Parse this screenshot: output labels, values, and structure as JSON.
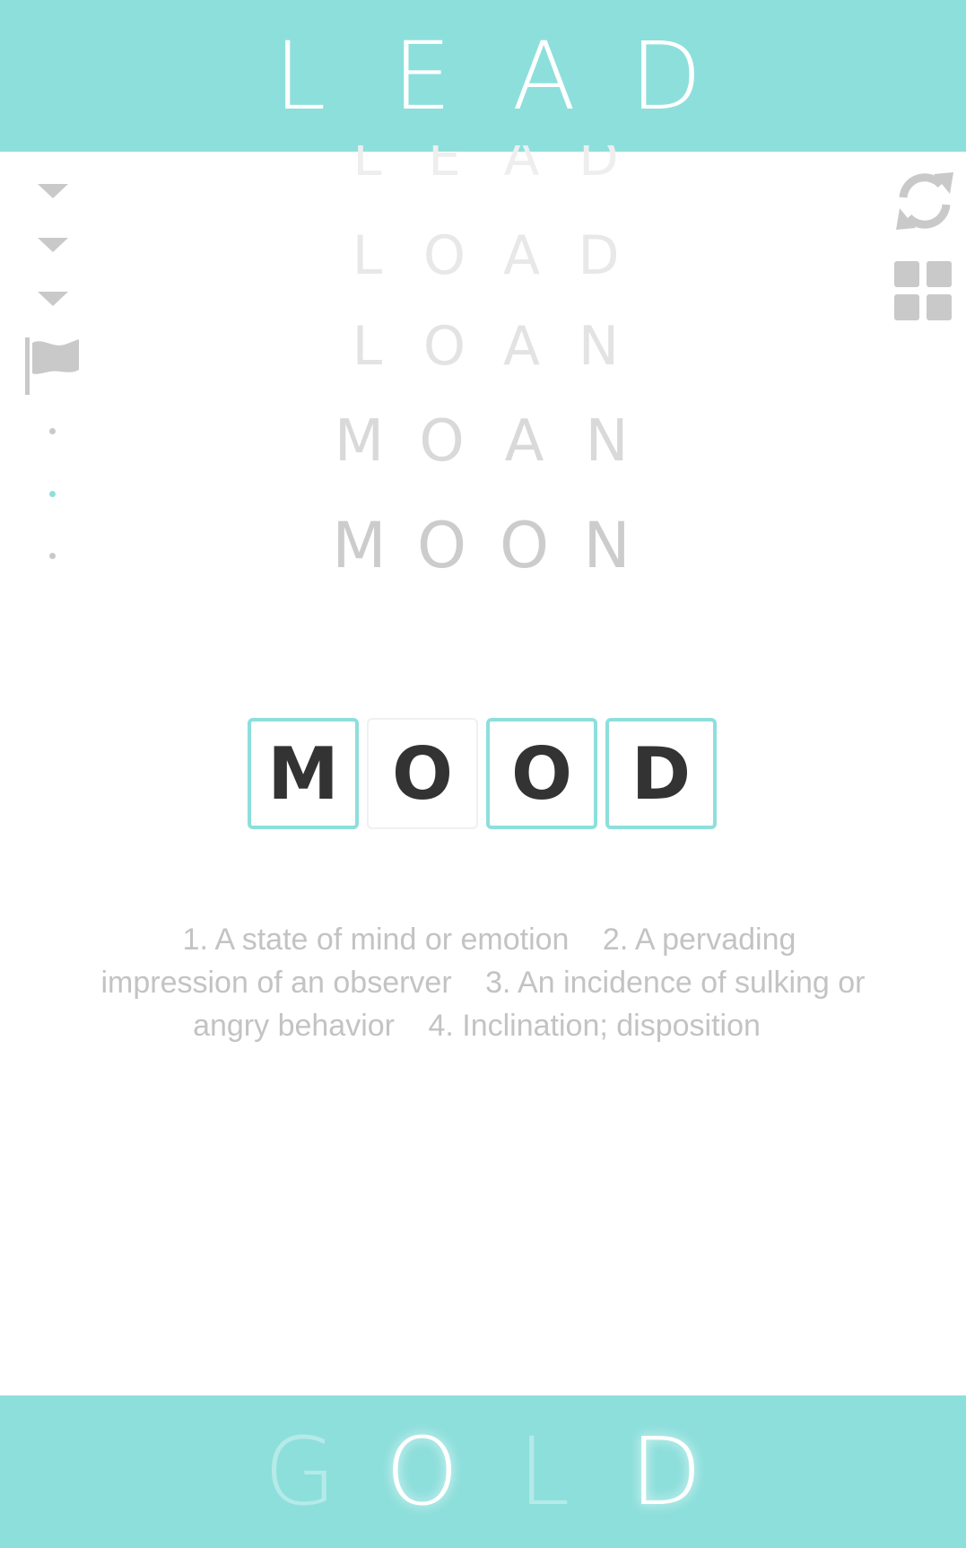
{
  "start_word": [
    "L",
    "E",
    "A",
    "D"
  ],
  "target_word": [
    "G",
    "O",
    "L",
    "D"
  ],
  "target_matched": [
    false,
    true,
    false,
    true
  ],
  "history": [
    {
      "letters": [
        "L",
        "E",
        "A",
        "D"
      ],
      "color": "#eeeeee"
    },
    {
      "letters": [
        "L",
        "O",
        "A",
        "D"
      ],
      "color": "#e8e8e8"
    },
    {
      "letters": [
        "L",
        "O",
        "A",
        "N"
      ],
      "color": "#e3e3e3"
    },
    {
      "letters": [
        "M",
        "O",
        "A",
        "N"
      ],
      "color": "#d9d9d9"
    },
    {
      "letters": [
        "M",
        "O",
        "O",
        "N"
      ],
      "color": "#cccccc"
    }
  ],
  "current_word": [
    "M",
    "O",
    "O",
    "D"
  ],
  "definitions": [
    "1. A state of mind or emotion",
    "2. A pervading impression of an observer",
    "3. An incidence of sulking or angry behavior",
    "4. Inclination; disposition"
  ],
  "icons": {
    "refresh": "refresh-icon",
    "menu": "grid-icon",
    "flag": "flag-icon",
    "collapse": "chevron-down-icon"
  },
  "colors": {
    "accent": "#8ddfdc",
    "text_dark": "#333333",
    "text_muted": "#c3c3c3",
    "icon_grey": "#c9c9c9"
  }
}
